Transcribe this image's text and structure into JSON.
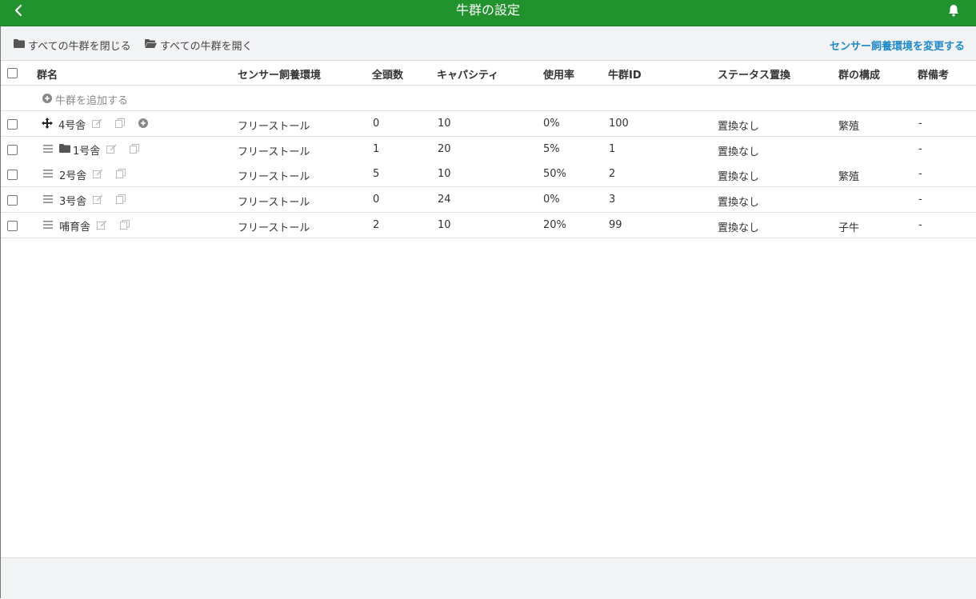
{
  "header": {
    "title": "牛群の設定",
    "back_icon": "chevron-left-icon",
    "bell_icon": "bell-icon"
  },
  "toolbar": {
    "collapse_all": "すべての牛群を閉じる",
    "expand_all": "すべての牛群を開く",
    "change_env": "センサー飼養環境を変更する"
  },
  "columns": {
    "name": "群名",
    "env": "センサー飼養環境",
    "count": "全頭数",
    "capacity": "キャパシティ",
    "usage": "使用率",
    "group_id": "牛群ID",
    "status": "ステータス置換",
    "composition": "群の構成",
    "remarks": "群備考"
  },
  "add_group": "牛群を追加する",
  "rows": [
    {
      "name": "4号舎",
      "env": "フリーストール",
      "count": "0",
      "capacity": "10",
      "usage": "0%",
      "group_id": "100",
      "status": "置換なし",
      "composition": "繁殖",
      "remarks": "-"
    },
    {
      "name": "1号舎",
      "env": "フリーストール",
      "count": "1",
      "capacity": "20",
      "usage": "5%",
      "group_id": "1",
      "status": "置換なし",
      "composition": "",
      "remarks": "-"
    },
    {
      "name": "2号舎",
      "env": "フリーストール",
      "count": "5",
      "capacity": "10",
      "usage": "50%",
      "group_id": "2",
      "status": "置換なし",
      "composition": "繁殖",
      "remarks": "-"
    },
    {
      "name": "3号舎",
      "env": "フリーストール",
      "count": "0",
      "capacity": "24",
      "usage": "0%",
      "group_id": "3",
      "status": "置換なし",
      "composition": "",
      "remarks": "-"
    },
    {
      "name": "哺育舎",
      "env": "フリーストール",
      "count": "2",
      "capacity": "10",
      "usage": "20%",
      "group_id": "99",
      "status": "置換なし",
      "composition": "子牛",
      "remarks": "-"
    }
  ],
  "colors": {
    "header_bg": "#22922e",
    "link": "#1e88c8",
    "toolbar_bg": "#f2f3f5"
  }
}
